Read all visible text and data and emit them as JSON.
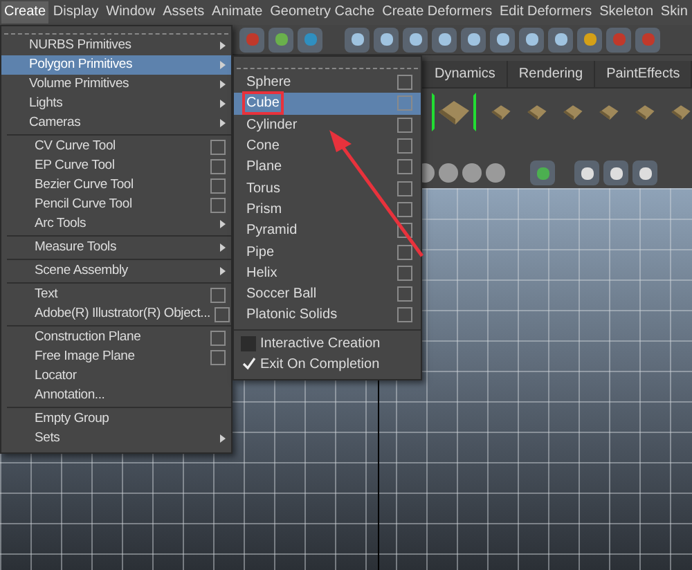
{
  "menubar": [
    {
      "label": "Create",
      "selected": true
    },
    {
      "label": "Display",
      "selected": false
    },
    {
      "label": "Window",
      "selected": false
    },
    {
      "label": "Assets",
      "selected": false
    },
    {
      "label": "Animate",
      "selected": false
    },
    {
      "label": "Geometry Cache",
      "selected": false
    },
    {
      "label": "Create Deformers",
      "selected": false
    },
    {
      "label": "Edit Deformers",
      "selected": false
    },
    {
      "label": "Skeleton",
      "selected": false
    },
    {
      "label": "Skin",
      "selected": false
    }
  ],
  "shelf_tabs": [
    {
      "label": "Dynamics",
      "selected": false
    },
    {
      "label": "Rendering",
      "selected": false
    },
    {
      "label": "PaintEffects",
      "selected": false
    }
  ],
  "create_menu": {
    "sections": [
      [
        {
          "label": "NURBS Primitives",
          "kind": "submenu",
          "selected": false
        },
        {
          "label": "Polygon Primitives",
          "kind": "submenu",
          "selected": true
        },
        {
          "label": "Volume Primitives",
          "kind": "submenu",
          "selected": false
        },
        {
          "label": "Lights",
          "kind": "submenu",
          "selected": false
        },
        {
          "label": "Cameras",
          "kind": "submenu",
          "selected": false
        }
      ],
      [
        {
          "label": "CV Curve Tool",
          "kind": "option",
          "selected": false
        },
        {
          "label": "EP Curve Tool",
          "kind": "option",
          "selected": false
        },
        {
          "label": "Bezier Curve Tool",
          "kind": "option",
          "selected": false
        },
        {
          "label": "Pencil Curve Tool",
          "kind": "option",
          "selected": false
        },
        {
          "label": "Arc Tools",
          "kind": "submenu",
          "selected": false
        }
      ],
      [
        {
          "label": "Measure Tools",
          "kind": "submenu",
          "selected": false
        }
      ],
      [
        {
          "label": "Scene Assembly",
          "kind": "submenu",
          "selected": false
        }
      ],
      [
        {
          "label": "Text",
          "kind": "option",
          "selected": false
        },
        {
          "label": "Adobe(R) Illustrator(R) Object...",
          "kind": "option",
          "selected": false
        }
      ],
      [
        {
          "label": "Construction Plane",
          "kind": "option",
          "selected": false
        },
        {
          "label": "Free Image Plane",
          "kind": "option",
          "selected": false
        },
        {
          "label": "Locator",
          "kind": "plain",
          "selected": false
        },
        {
          "label": "Annotation...",
          "kind": "plain",
          "selected": false
        }
      ],
      [
        {
          "label": "Empty Group",
          "kind": "plain",
          "selected": false
        },
        {
          "label": "Sets",
          "kind": "submenu",
          "selected": false
        }
      ]
    ]
  },
  "polygon_submenu": {
    "items": [
      {
        "label": "Sphere",
        "selected": false,
        "annotated": false
      },
      {
        "label": "Cube",
        "selected": true,
        "annotated": true
      },
      {
        "label": "Cylinder",
        "selected": false,
        "annotated": false
      },
      {
        "label": "Cone",
        "selected": false,
        "annotated": false
      },
      {
        "label": "Plane",
        "selected": false,
        "annotated": false
      },
      {
        "label": "Torus",
        "selected": false,
        "annotated": false
      },
      {
        "label": "Prism",
        "selected": false,
        "annotated": false
      },
      {
        "label": "Pyramid",
        "selected": false,
        "annotated": false
      },
      {
        "label": "Pipe",
        "selected": false,
        "annotated": false
      },
      {
        "label": "Helix",
        "selected": false,
        "annotated": false
      },
      {
        "label": "Soccer Ball",
        "selected": false,
        "annotated": false
      },
      {
        "label": "Platonic Solids",
        "selected": false,
        "annotated": false
      }
    ],
    "toggles": [
      {
        "label": "Interactive Creation",
        "checked": false
      },
      {
        "label": "Exit On Completion",
        "checked": true
      }
    ]
  }
}
